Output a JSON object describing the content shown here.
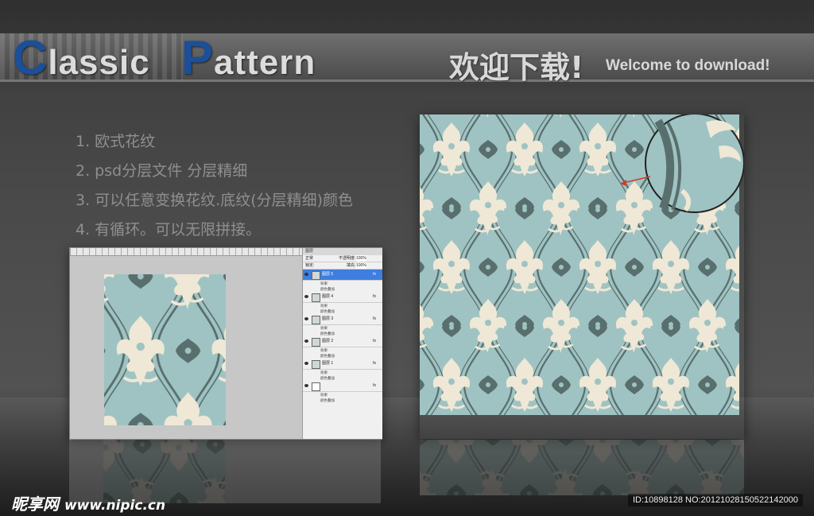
{
  "header": {
    "title_word1_initial": "C",
    "title_word1_rest": "lassic",
    "title_word2_initial": "P",
    "title_word2_rest": "attern",
    "welcome_cn": "欢迎下载!",
    "welcome_en": "Welcome to download!"
  },
  "features": [
    "1. 欧式花纹",
    "2. psd分层文件 分层精细",
    "3. 可以任意变换花纹.底纹(分层精细)颜色",
    "4. 有循环。可以无限拼接。"
  ],
  "layers_panel": {
    "tab": "图层",
    "blend_mode": "正常",
    "opacity_label": "不透明度:",
    "opacity_value": "100%",
    "lock_label": "锁定:",
    "fill_label": "填充:",
    "fill_value": "100%",
    "layers": [
      {
        "name": "图层 5",
        "selected": true
      },
      {
        "name": "图层 4",
        "selected": false
      },
      {
        "name": "图层 3",
        "selected": false
      },
      {
        "name": "图层 2",
        "selected": false
      },
      {
        "name": "图层 1",
        "selected": false
      },
      {
        "name": "",
        "selected": false
      }
    ],
    "effects_label": "效果",
    "overlay_label": "颜色叠加",
    "fx_label": "fx"
  },
  "colors": {
    "pattern_bg": "#9fc3c2",
    "pattern_ornament": "#efe8d6",
    "pattern_line": "#586f6e",
    "title_blue": "#1b4f9a"
  },
  "watermark": {
    "site": "昵享网",
    "url": "www.nipic.cn",
    "id_text": "ID:10898128 NO:20121028150522142000"
  }
}
